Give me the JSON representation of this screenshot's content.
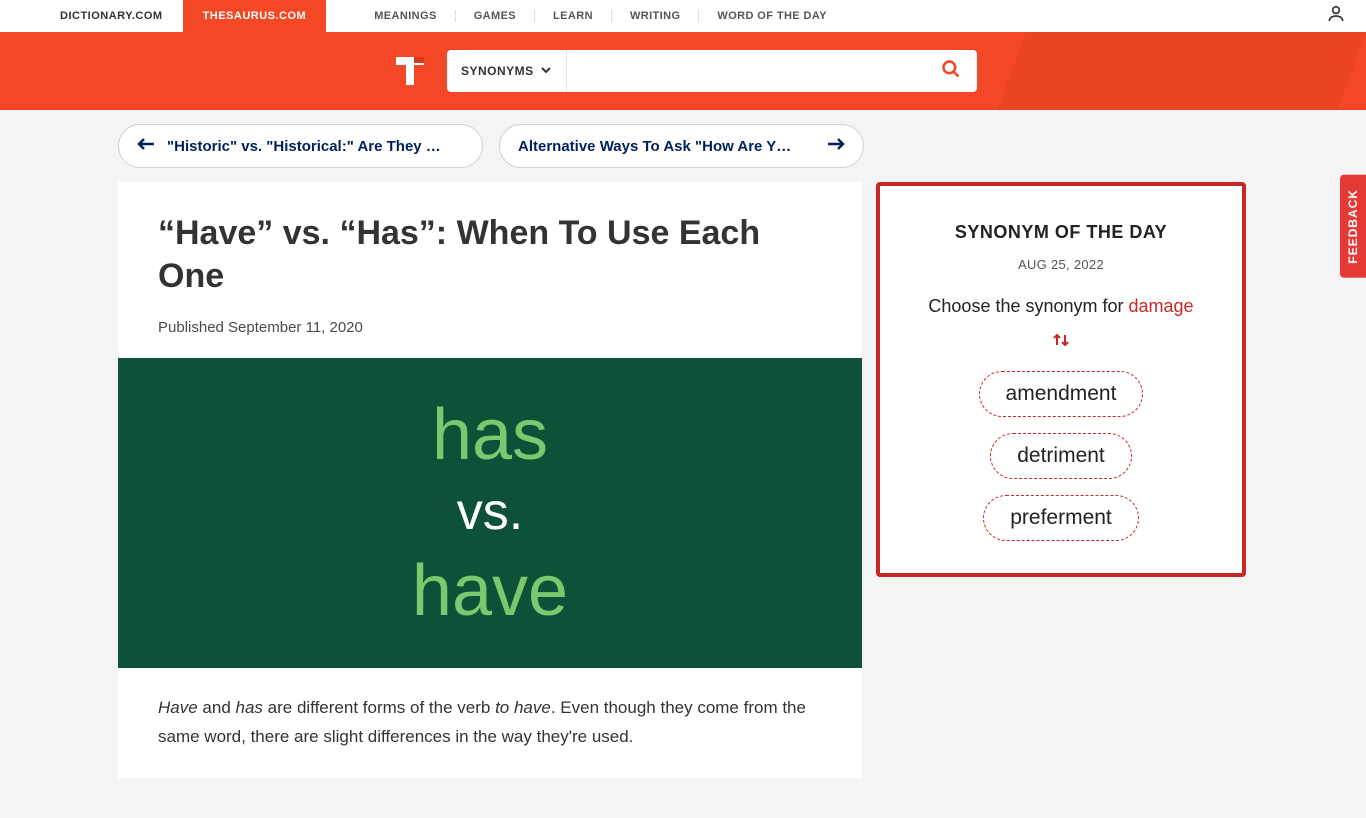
{
  "topNav": {
    "siteTabs": [
      {
        "label": "DICTIONARY.COM",
        "active": false
      },
      {
        "label": "THESAURUS.COM",
        "active": true
      }
    ],
    "links": [
      "MEANINGS",
      "GAMES",
      "LEARN",
      "WRITING",
      "WORD OF THE DAY"
    ]
  },
  "search": {
    "dropdownLabel": "SYNONYMS",
    "placeholder": ""
  },
  "navPills": {
    "prev": "\"Historic\" vs. \"Historical:\" Are They …",
    "next": "Alternative Ways To Ask \"How Are Y…"
  },
  "article": {
    "title": "“Have” vs. “Has”: When To Use Each One",
    "published": "Published September 11, 2020",
    "hero": {
      "w1": "has",
      "w2": "vs.",
      "w3": "have"
    },
    "body_html": "<em>Have</em> and <em>has</em> are different forms of the verb <em>to have</em>. Even though they come from the same word, there are slight differences in the way they're used."
  },
  "sotd": {
    "title": "SYNONYM OF THE DAY",
    "date": "AUG 25, 2022",
    "prompt_pre": "Choose the synonym for ",
    "word": "damage",
    "options": [
      "amendment",
      "detriment",
      "preferment"
    ]
  },
  "feedback": "FEEDBACK"
}
